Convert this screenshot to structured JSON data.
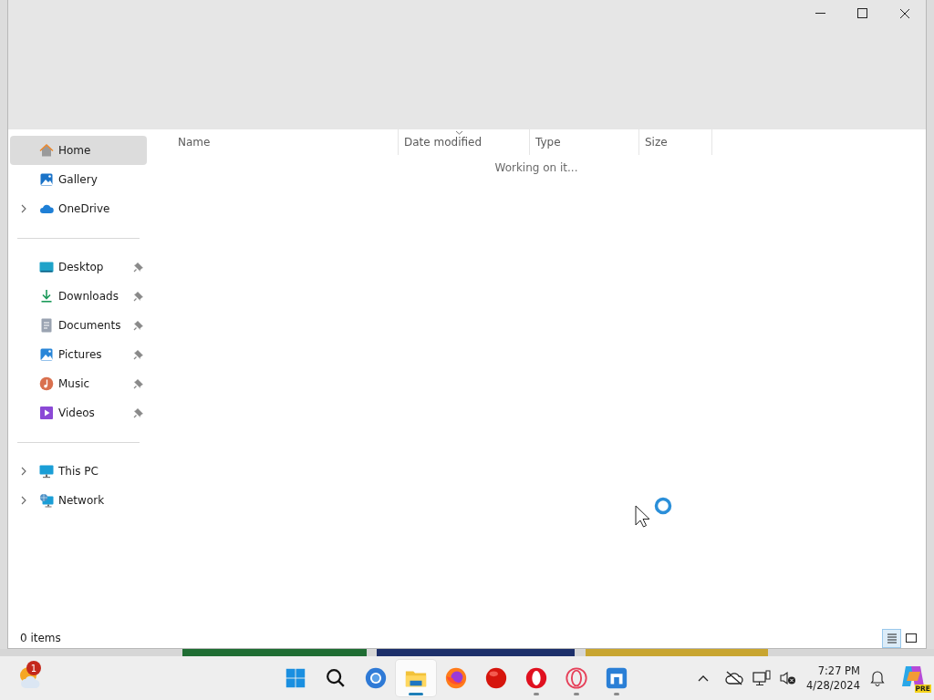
{
  "sidebar": {
    "groups": [
      {
        "items": [
          {
            "label": "Home",
            "selected": true,
            "expandable": false,
            "pinned": false
          },
          {
            "label": "Gallery",
            "selected": false,
            "expandable": false,
            "pinned": false
          },
          {
            "label": "OneDrive",
            "selected": false,
            "expandable": true,
            "pinned": false
          }
        ]
      },
      {
        "items": [
          {
            "label": "Desktop",
            "selected": false,
            "expandable": false,
            "pinned": true
          },
          {
            "label": "Downloads",
            "selected": false,
            "expandable": false,
            "pinned": true
          },
          {
            "label": "Documents",
            "selected": false,
            "expandable": false,
            "pinned": true
          },
          {
            "label": "Pictures",
            "selected": false,
            "expandable": false,
            "pinned": true
          },
          {
            "label": "Music",
            "selected": false,
            "expandable": false,
            "pinned": true
          },
          {
            "label": "Videos",
            "selected": false,
            "expandable": false,
            "pinned": true
          }
        ]
      },
      {
        "items": [
          {
            "label": "This PC",
            "selected": false,
            "expandable": true,
            "pinned": false
          },
          {
            "label": "Network",
            "selected": false,
            "expandable": true,
            "pinned": false
          }
        ]
      }
    ]
  },
  "file_list": {
    "columns": [
      {
        "label": "Name",
        "sorted": false
      },
      {
        "label": "Date modified",
        "sorted": true
      },
      {
        "label": "Type",
        "sorted": false
      },
      {
        "label": "Size",
        "sorted": false
      }
    ],
    "message": "Working on it..."
  },
  "status_bar": {
    "item_count": "0 items",
    "views": [
      {
        "selected": true
      },
      {
        "selected": false
      }
    ]
  },
  "taskbar": {
    "weather_badge": "1",
    "apps": [
      {
        "selected": false,
        "running": false
      },
      {
        "selected": false,
        "running": false
      },
      {
        "selected": false,
        "running": false
      },
      {
        "selected": true,
        "running": true
      },
      {
        "selected": false,
        "running": false
      },
      {
        "selected": false,
        "running": false
      },
      {
        "selected": false,
        "running": true
      },
      {
        "selected": false,
        "running": true
      },
      {
        "selected": false,
        "running": true
      }
    ],
    "time": "7:27 PM",
    "date": "4/28/2024",
    "copilot_badge": "PRE"
  }
}
